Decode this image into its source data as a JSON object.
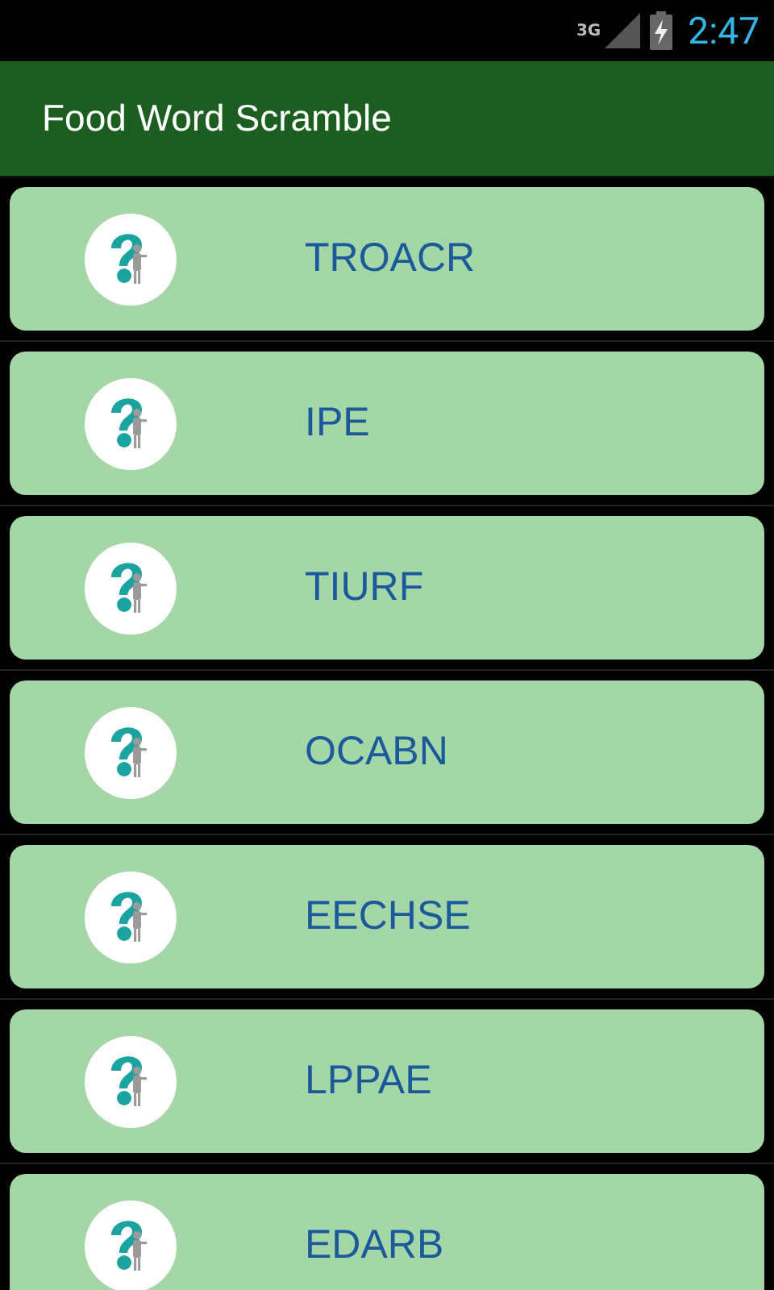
{
  "status_bar": {
    "network": "3G",
    "time": "2:47"
  },
  "app_bar": {
    "title": "Food Word Scramble"
  },
  "words": [
    {
      "text": "TROACR"
    },
    {
      "text": "IPE"
    },
    {
      "text": "TIURF"
    },
    {
      "text": "OCABN"
    },
    {
      "text": "EECHSE"
    },
    {
      "text": "LPPAE"
    },
    {
      "text": "EDARB"
    }
  ]
}
